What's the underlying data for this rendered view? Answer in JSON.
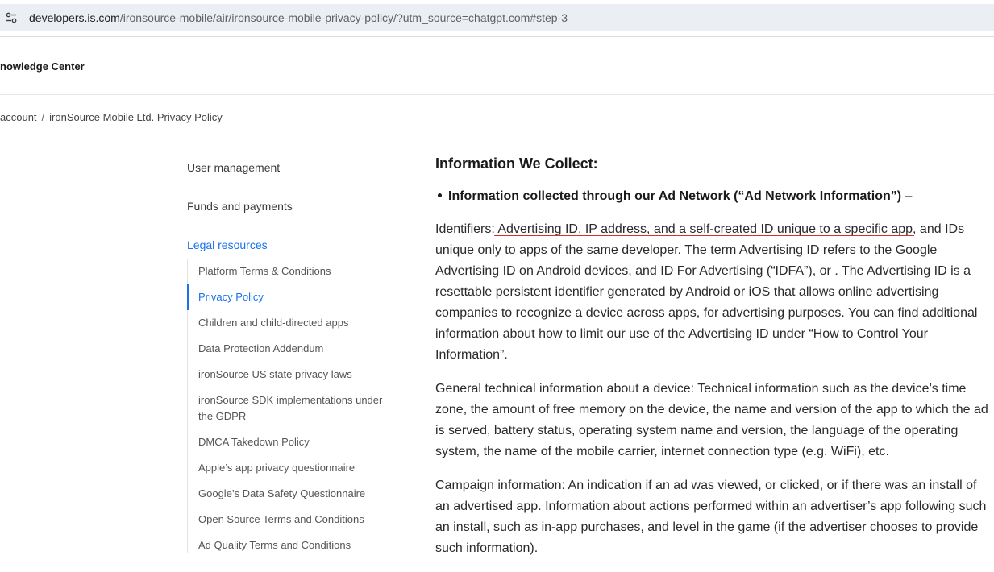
{
  "browser": {
    "url_host": "developers.is.com",
    "url_path": "/ironsource-mobile/air/ironsource-mobile-privacy-policy/?utm_source=chatgpt.com#step-3"
  },
  "site": {
    "title": "nowledge Center"
  },
  "breadcrumb": {
    "items": [
      "account",
      "ironSource Mobile Ltd. Privacy Policy"
    ],
    "separator": "/"
  },
  "sidebar": {
    "sections": [
      {
        "label": "User management"
      },
      {
        "label": "Funds and payments"
      },
      {
        "label": "Legal resources"
      }
    ],
    "legal_items": [
      {
        "label": "Platform Terms & Conditions"
      },
      {
        "label": "Privacy Policy"
      },
      {
        "label": "Children and child-directed apps"
      },
      {
        "label": "Data Protection Addendum"
      },
      {
        "label": "ironSource US state privacy laws"
      },
      {
        "label": "ironSource SDK implementations under the GDPR"
      },
      {
        "label": "DMCA Takedown Policy"
      },
      {
        "label": "Apple’s app privacy questionnaire"
      },
      {
        "label": "Google’s Data Safety Questionnaire"
      },
      {
        "label": "Open Source Terms and Conditions"
      },
      {
        "label": "Ad Quality Terms and Conditions"
      }
    ]
  },
  "content": {
    "heading": "Information We Collect:",
    "bullet": "Information collected through our Ad Network (“Ad Network Information”)",
    "bullet_dash": "–",
    "identifiers_prefix": "Identifiers: ",
    "identifiers_highlight": "Advertising ID, IP address, and a self-created ID unique to a specific app",
    "identifiers_rest": ", and IDs unique only to apps of the same developer. The term Advertising ID refers to the Google Advertising ID on Android devices, and ID For Advertising (“IDFA”), or . The Advertising ID is a resettable persistent identifier generated by Android or iOS that allows online advertising companies to recognize a device across apps, for advertising purposes. You can find additional information about how to limit our use of the Advertising ID under “How to Control Your Information”.",
    "technical": "General technical information about a device: Technical information such as the device’s time zone, the amount of free memory on the device, the name and version of the app to which the ad is served, battery status, operating system name and version,  the language of the operating system, the name of the mobile carrier, internet connection type (e.g. WiFi), etc.",
    "campaign": "Campaign information: An indication if an ad was viewed, or clicked, or if there was an install of an advertised app. Information about actions performed within an advertiser’s app following such an install, such as in-app purchases, and level in the game (if the advertiser chooses to provide such information)."
  },
  "colors": {
    "accent": "#1a73e8",
    "annotation_underline": "#d93025"
  }
}
